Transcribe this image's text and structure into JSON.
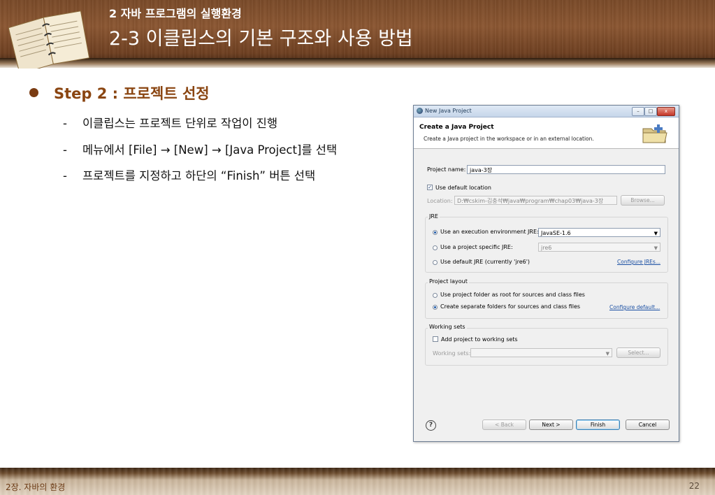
{
  "header": {
    "subtitle": "2 자바 프로그램의 실행환경",
    "title": "2-3 이클립스의 기본 구조와 사용 방법"
  },
  "content": {
    "step": "Step 2 : 프로젝트 선정",
    "items": [
      "이클립스는 프로젝트 단위로 작업이 진행",
      "메뉴에서 [File] → [New] → [Java Project]를 선택",
      "프로젝트를 지정하고 하단의 “Finish” 버튼 선택"
    ],
    "dash": "-"
  },
  "dialog": {
    "window_title": "New Java Project",
    "banner_title": "Create a Java Project",
    "banner_desc": "Create a Java project in the workspace or in an external location.",
    "project_name_label": "Project name:",
    "project_name_value": "java-3장",
    "use_default_location": "Use default location",
    "location_label": "Location:",
    "location_value": "D:₩cskim-김충석₩java₩program₩chap03₩java-3장",
    "browse": "Browse...",
    "jre_group": "JRE",
    "jre_opt1": "Use an execution environment JRE:",
    "jre_opt1_value": "JavaSE-1.6",
    "jre_opt2": "Use a project specific JRE:",
    "jre_opt2_value": "jre6",
    "jre_opt3": "Use default JRE (currently 'jre6')",
    "configure_jres": "Configure JREs...",
    "layout_group": "Project layout",
    "layout_opt1": "Use project folder as root for sources and class files",
    "layout_opt2": "Create separate folders for sources and class files",
    "configure_default": "Configure default...",
    "ws_group": "Working sets",
    "ws_add": "Add project to working sets",
    "ws_label": "Working sets:",
    "select": "Select...",
    "help": "?",
    "back": "< Back",
    "next": "Next >",
    "finish": "Finish",
    "cancel": "Cancel",
    "minimize": "–",
    "maximize": "□",
    "close": "x"
  },
  "footer": {
    "chapter": "2장. 자바의 환경",
    "page": "22"
  }
}
